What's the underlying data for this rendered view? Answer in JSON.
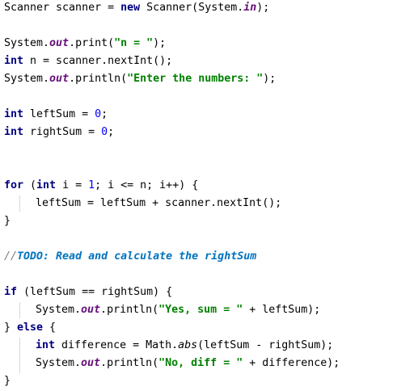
{
  "code": {
    "l1": {
      "a": "Scanner scanner = ",
      "kw": "new",
      "b": " Scanner(System.",
      "fld": "in",
      "c": ");"
    },
    "l2": {
      "a": "System.",
      "fld": "out",
      "b": ".print(",
      "str": "\"n = \"",
      "c": ");"
    },
    "l3": {
      "kw": "int",
      "a": " n = scanner.nextInt();"
    },
    "l4": {
      "a": "System.",
      "fld": "out",
      "b": ".println(",
      "str": "\"Enter the numbers: \"",
      "c": ");"
    },
    "l5": {
      "kw": "int",
      "a": " leftSum = ",
      "num": "0",
      "b": ";"
    },
    "l6": {
      "kw": "int",
      "a": " rightSum = ",
      "num": "0",
      "b": ";"
    },
    "l7": {
      "kw1": "for",
      "a": " (",
      "kw2": "int",
      "b": " i = ",
      "num": "1",
      "c": "; i <= n; i++) {"
    },
    "l8": {
      "a": "leftSum = leftSum + scanner.nextInt();"
    },
    "l9": {
      "a": "}"
    },
    "l10": {
      "slashes": "//",
      "todo": "TODO: Read and calculate the rightSum"
    },
    "l11": {
      "kw": "if",
      "a": " (leftSum == rightSum) {"
    },
    "l12": {
      "a": "System.",
      "fld": "out",
      "b": ".println(",
      "str": "\"Yes, sum = \"",
      "c": " + leftSum);"
    },
    "l13": {
      "a": "} ",
      "kw": "else",
      "b": " {"
    },
    "l14": {
      "kw": "int",
      "a": " difference = Math.",
      "ital": "abs",
      "b": "(leftSum - rightSum);"
    },
    "l15": {
      "a": "System.",
      "fld": "out",
      "b": ".println(",
      "str": "\"No, diff = \"",
      "c": " + difference);"
    },
    "l16": {
      "a": "}"
    }
  },
  "colors": {
    "keyword": "#000080",
    "number": "#0000ff",
    "string": "#008000",
    "field": "#660e7a",
    "comment": "#808080",
    "todo": "#0073bf",
    "indent_guide": "#d7d7d7"
  }
}
